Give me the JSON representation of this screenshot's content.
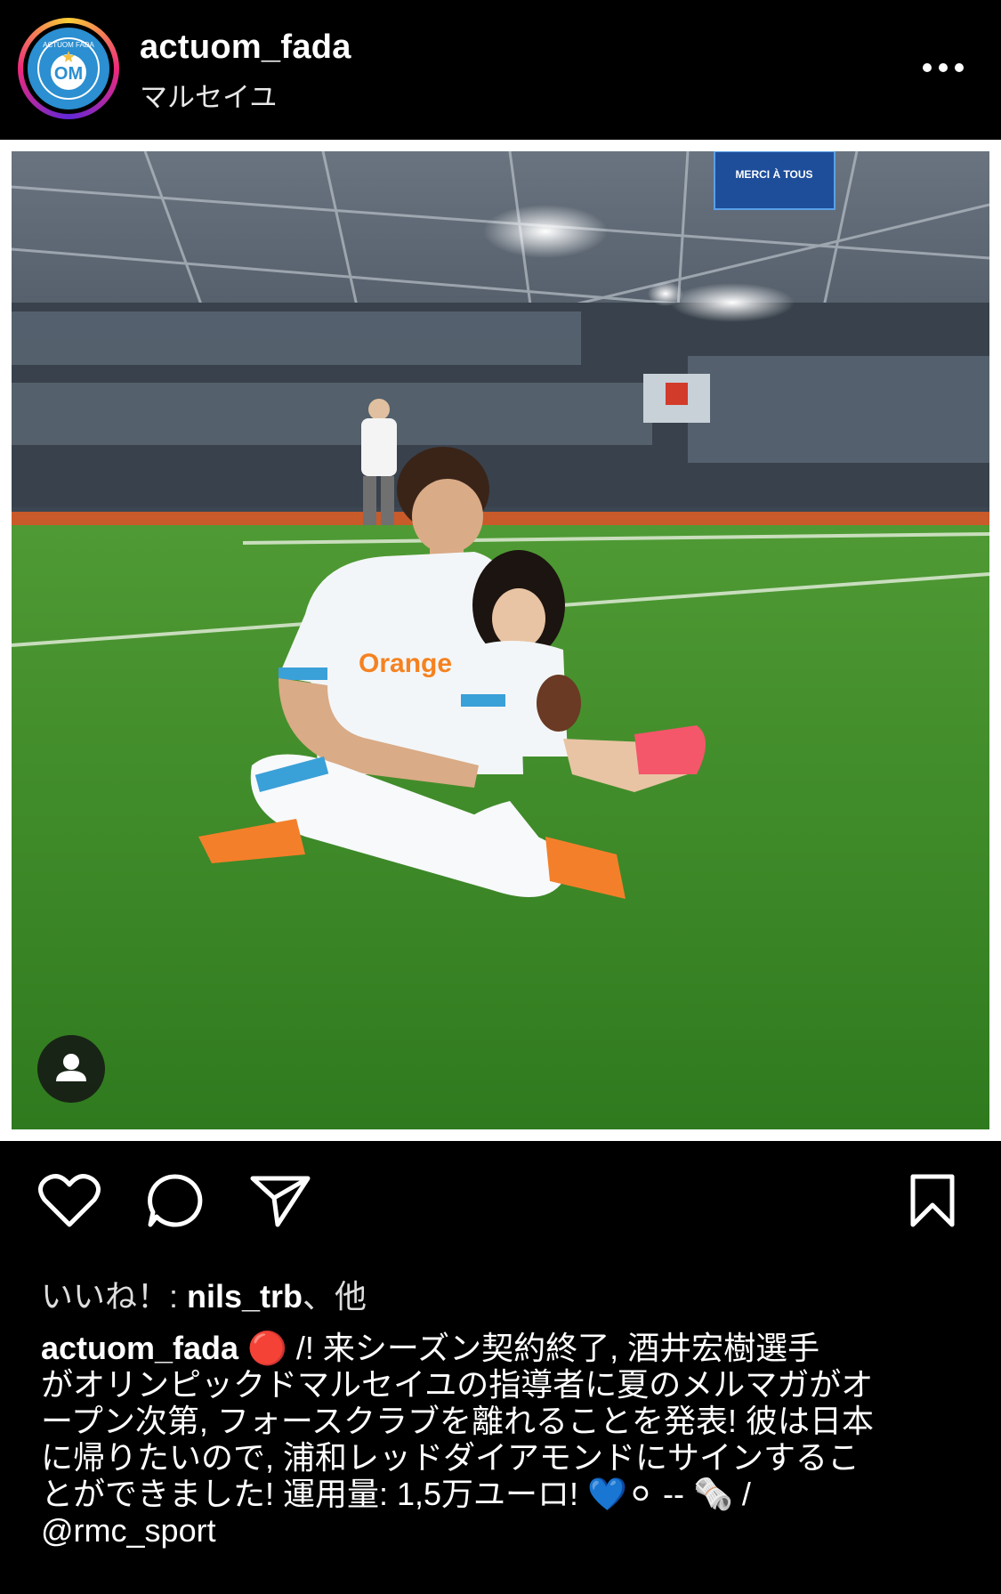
{
  "post": {
    "username": "actuom_fada",
    "location": "マルセイユ",
    "avatar_logo_text": "OM",
    "avatar_ring_text": "ACTUOM FADA"
  },
  "icons": {
    "more": "more-horizontal-icon",
    "tag": "user-tag-icon",
    "like": "heart-icon",
    "comment": "comment-icon",
    "share": "send-icon",
    "save": "bookmark-icon"
  },
  "photo_text": {
    "scoreboard": "MERCI À TOUS",
    "shirt_sponsor": "Orange"
  },
  "likes": {
    "prefix": "いいね！: ",
    "user": "nils_trb",
    "suffix": "、他"
  },
  "caption": {
    "user": "actuom_fada",
    "line1": " 🔴 /! 来シーズン契約終了, 酒井宏樹選手",
    "line2": "がオリンピックドマルセイユの指導者に夏のメルマガがオ",
    "line3": "ープン次第, フォースクラブを離れることを発表! 彼は日本",
    "line4": "に帰りたいので, 浦和レッドダイアモンドにサインするこ",
    "line5": "とができました! 運用量: 1,5万ユーロ! 💙⚪ -- 🗞️ /",
    "line6": "@rmc_sport"
  },
  "colors": {
    "background": "#000000",
    "avatar_blue": "#2b8fd1",
    "pitch": "#3f8f28"
  }
}
